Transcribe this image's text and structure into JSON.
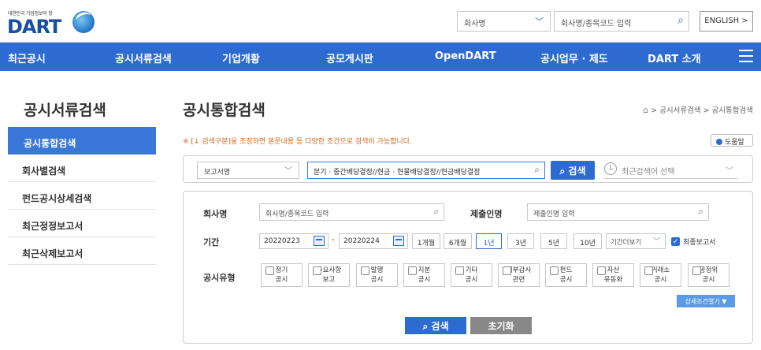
{
  "header": {
    "logo_small": "대한민국 기업정보의 창",
    "logo": "DART",
    "company_select": "회사명",
    "search_placeholder": "회사명/종목코드 입력",
    "english_button": "ENGLISH >"
  },
  "nav": {
    "items": [
      "최근공시",
      "공시서류검색",
      "기업개황",
      "공모게시판",
      "OpenDART",
      "공시업무 · 제도",
      "DART 소개"
    ]
  },
  "sidebar": {
    "title": "공시서류검색",
    "items": [
      "공시통합검색",
      "회사별검색",
      "펀드공시상세검색",
      "최근정정보고서",
      "최근삭제보고서"
    ]
  },
  "main": {
    "title": "공시통합검색",
    "breadcrumb": "공시서류검색 > 공시통합검색",
    "breadcrumb_sep": ">",
    "notice": "※ [↓ 검색구분]을 조정하면 본문내용 등 다양한 조건으로 검색이 가능합니다.",
    "help": "도움말",
    "report_type": "보고서명",
    "keyword": "분기 · 중간배당결정//현금 · 현물배당결정//현금배당결정",
    "search_button": "검색",
    "recent_search": "최근검색어 선택"
  },
  "filters": {
    "company_label": "회사명",
    "company_placeholder": "회사명/종목코드 입력",
    "submitter_label": "제출인명",
    "submitter_placeholder": "제출인명 입력",
    "period_label": "기간",
    "date_from": "20220223",
    "date_sep": "-",
    "date_to": "20220224",
    "period_buttons": [
      "1개월",
      "6개월",
      "1년",
      "3년",
      "5년",
      "10년"
    ],
    "period_selected": "1년",
    "period_more": "기간더보기",
    "final_report": "최종보고서",
    "final_report_checked": true,
    "type_label": "공시유형",
    "types": [
      {
        "l1": "정기",
        "l2": "공시"
      },
      {
        "l1": "주요사항",
        "l2": "보고"
      },
      {
        "l1": "발행",
        "l2": "공시"
      },
      {
        "l1": "지분",
        "l2": "공시"
      },
      {
        "l1": "기타",
        "l2": "공시"
      },
      {
        "l1": "외부감사",
        "l2": "관련"
      },
      {
        "l1": "펀드",
        "l2": "공시"
      },
      {
        "l1": "자산",
        "l2": "유동화"
      },
      {
        "l1": "거래소",
        "l2": "공시"
      },
      {
        "l1": "공정위",
        "l2": "공시"
      }
    ],
    "detail_button": "상세조건열기 ▼",
    "search_button": "검색",
    "reset_button": "초기화"
  },
  "colors": {
    "primary": "#2d6bd0",
    "notice": "#d2691e",
    "reset": "#888888"
  }
}
